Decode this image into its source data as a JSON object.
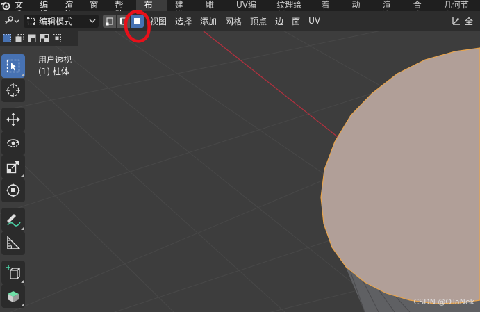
{
  "menubar": {
    "items": [
      {
        "label": "文件"
      },
      {
        "label": "编辑"
      },
      {
        "label": "渲染"
      },
      {
        "label": "窗口"
      },
      {
        "label": "帮助"
      }
    ],
    "workspaces": [
      {
        "label": "布局",
        "active": true
      },
      {
        "label": "建模"
      },
      {
        "label": "雕刻"
      },
      {
        "label": "UV编辑"
      },
      {
        "label": "纹理绘制"
      },
      {
        "label": "着色"
      },
      {
        "label": "动画"
      },
      {
        "label": "渲染"
      },
      {
        "label": "合成"
      },
      {
        "label": "几何节点"
      }
    ]
  },
  "header": {
    "mode_label": "编辑模式",
    "menus": [
      {
        "label": "视图"
      },
      {
        "label": "选择"
      },
      {
        "label": "添加"
      },
      {
        "label": "网格"
      },
      {
        "label": "顶点"
      },
      {
        "label": "边"
      },
      {
        "label": "面"
      },
      {
        "label": "UV"
      }
    ],
    "right_label": "全"
  },
  "selection_mode": {
    "active": "face"
  },
  "viewport": {
    "view_name": "用户透视",
    "object_label": "(1) 柱体"
  },
  "toolbar": {
    "active_tool": "select-box"
  },
  "watermark": "CSDN @OTaNek",
  "colors": {
    "accent": "#4772b3",
    "face_fill": "#b19f98",
    "edge_orange": "#e8a44c",
    "annotation_red": "#e8101a",
    "x_axis": "#b3303e"
  }
}
